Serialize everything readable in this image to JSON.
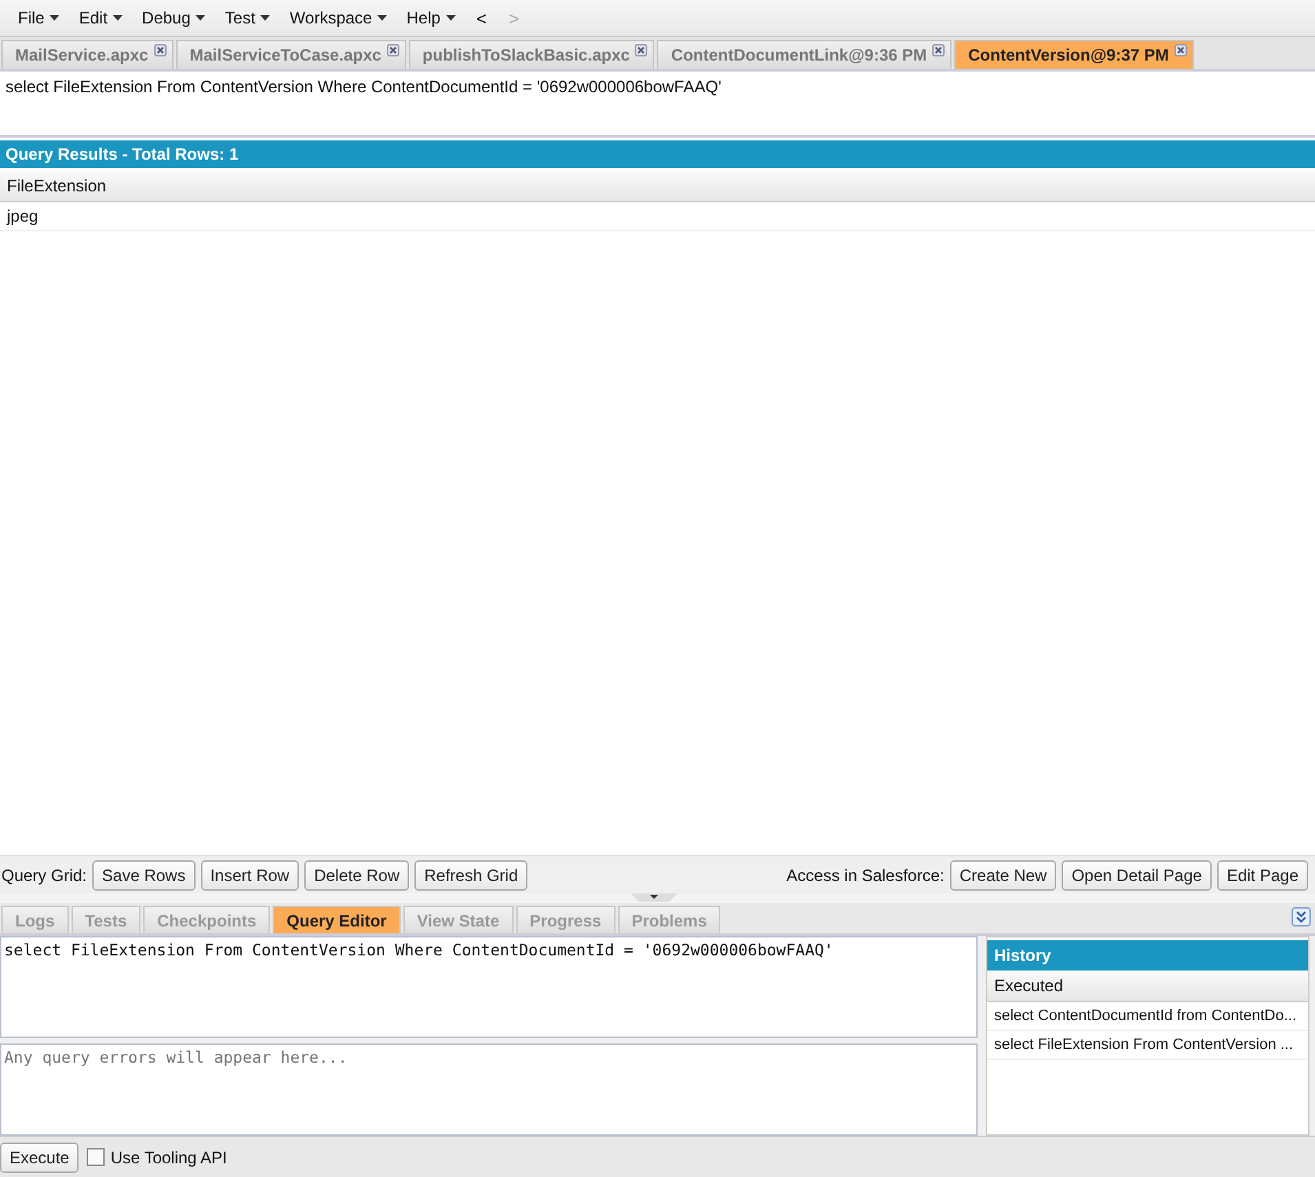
{
  "menu": [
    {
      "label": "File",
      "dropdown": true
    },
    {
      "label": "Edit",
      "dropdown": true
    },
    {
      "label": "Debug",
      "dropdown": true
    },
    {
      "label": "Test",
      "dropdown": true
    },
    {
      "label": "Workspace",
      "dropdown": true
    },
    {
      "label": "Help",
      "dropdown": true
    }
  ],
  "nav": [
    {
      "label": "<",
      "disabled": false
    },
    {
      "label": ">",
      "disabled": true
    }
  ],
  "editor_tabs": [
    {
      "label": "MailService.apxc",
      "selected": false
    },
    {
      "label": "MailServiceToCase.apxc",
      "selected": false
    },
    {
      "label": "publishToSlackBasic.apxc",
      "selected": false
    },
    {
      "label": "ContentDocumentLink@9:36 PM",
      "selected": false
    },
    {
      "label": "ContentVersion@9:37 PM",
      "selected": true
    }
  ],
  "query_text": "select FileExtension From ContentVersion Where ContentDocumentId = '0692w000006bowFAAQ'",
  "results": {
    "title": "Query Results - Total Rows: 1",
    "columns": [
      "FileExtension"
    ],
    "rows": [
      [
        "jpeg"
      ]
    ]
  },
  "grid_toolbar": {
    "label": "Query Grid:",
    "buttons": [
      "Save Rows",
      "Insert Row",
      "Delete Row",
      "Refresh Grid"
    ],
    "sf_label": "Access in Salesforce:",
    "sf_buttons": [
      "Create New",
      "Open Detail Page",
      "Edit Page"
    ]
  },
  "bottom_tabs": [
    {
      "label": "Logs",
      "selected": false
    },
    {
      "label": "Tests",
      "selected": false
    },
    {
      "label": "Checkpoints",
      "selected": false
    },
    {
      "label": "Query Editor",
      "selected": true
    },
    {
      "label": "View State",
      "selected": false
    },
    {
      "label": "Progress",
      "selected": false
    },
    {
      "label": "Problems",
      "selected": false
    }
  ],
  "query_editor": {
    "value": "select FileExtension From ContentVersion Where ContentDocumentId = '0692w000006bowFAAQ'",
    "errors_placeholder": "Any query errors will appear here..."
  },
  "history": {
    "title": "History",
    "column": "Executed",
    "rows": [
      "select ContentDocumentId from ContentDo...",
      "select FileExtension From ContentVersion ..."
    ]
  },
  "execute_button": "Execute",
  "tooling_api": {
    "label": "Use Tooling API",
    "checked": false
  }
}
